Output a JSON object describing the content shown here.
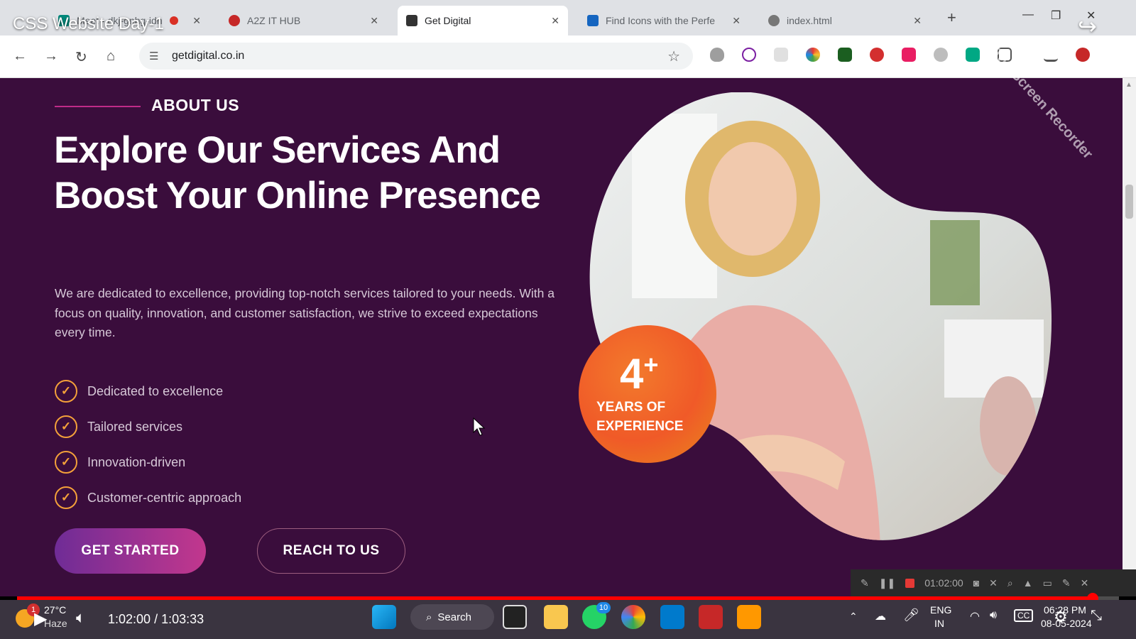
{
  "video": {
    "title": "CSS Website Day-1",
    "current_time": "1:02:00",
    "separator": "/",
    "duration": "1:03:33",
    "progress": 0.976,
    "watermark": "iTop Screen Recorder"
  },
  "browser": {
    "tabs": [
      {
        "label": "Meet - dkj-gnhg-idn"
      },
      {
        "label": "A2Z IT HUB"
      },
      {
        "label": "Get Digital",
        "active": true
      },
      {
        "label": "Find Icons with the Perfe"
      },
      {
        "label": "index.html"
      }
    ],
    "new_tab": "+",
    "url": "getdigital.co.in"
  },
  "page": {
    "eyebrow": "ABOUT US",
    "headline": "Explore Our Services And Boost Your Online Presence",
    "description": "We are dedicated to excellence, providing top-notch services tailored to your needs. With a focus on quality, innovation, and customer satisfaction, we strive to exceed expectations every time.",
    "features": [
      "Dedicated to excellence",
      "Tailored services",
      "Innovation-driven",
      "Customer-centric approach"
    ],
    "primary_button": "GET STARTED",
    "secondary_button": "REACH TO US",
    "badge": {
      "number": "4",
      "suffix": "+",
      "line1": "YEARS OF",
      "line2": "EXPERIENCE"
    },
    "colors": {
      "background": "#3a0d3c",
      "accent_orange": "#f05a28",
      "check": "#f4a13a",
      "gradient_start": "#6f2c96",
      "gradient_end": "#c2378d"
    }
  },
  "recorder": {
    "timer": "01:02:00"
  },
  "taskbar": {
    "weather_temp": "27°C",
    "weather_desc": "Haze",
    "weather_alert": "1",
    "search": "Search",
    "whatsapp_badge": "10",
    "lang": "ENG",
    "region": "IN",
    "clock": "06:28 PM",
    "date": "08-05-2024"
  }
}
